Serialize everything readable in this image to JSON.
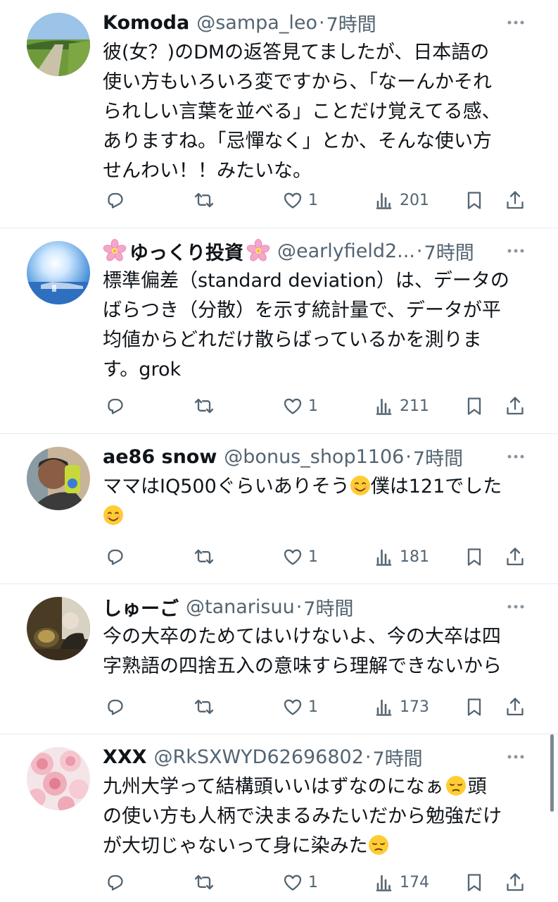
{
  "tweets": [
    {
      "name": "Komoda",
      "handle": "@sampa_leo",
      "separator": "·",
      "time": "7時間",
      "lines": [
        "彼(女？)のDMの返答見てましたが、日本語の",
        "使い方もいろいろ変ですから、「なーんかそれ",
        "られしい言葉を並べる」ことだけ覚えてる感、",
        "ありますね。「忌憚なく」とか、そんな使い方",
        "せんわい！！みたいな。"
      ],
      "likes": "1",
      "views": "201"
    },
    {
      "name": "ゆっくり投資",
      "handle": "@earlyfield2...",
      "separator": "·",
      "time": "7時間",
      "lines": [
        "標準偏差（standard deviation）は、データの",
        "ばらつき（分散）を示す統計量で、データが平",
        "均値からどれだけ散らばっているかを測りま",
        "す。grok"
      ],
      "likes": "1",
      "views": "211"
    },
    {
      "name": "ae86 snow",
      "handle": "@bonus_shop1106",
      "separator": "·",
      "time": "7時間",
      "line1_a": "ママはIQ500ぐらいありそう",
      "line1_b": "僕は121でした",
      "likes": "1",
      "views": "181"
    },
    {
      "name": "しゅーご",
      "handle": "@tanarisuu",
      "separator": "·",
      "time": "7時間",
      "lines": [
        "今の大卒のためてはいけないよ、今の大卒は四",
        "字熟語の四捨五入の意味すら理解できないから"
      ],
      "likes": "1",
      "views": "173"
    },
    {
      "name": "XXX",
      "handle": "@RkSXWYD62696802",
      "separator": "·",
      "time": "7時間",
      "line1_a": "九州大学って結構頭いいはずなのになぁ",
      "line1_b": "頭",
      "line2": "の使い方も人柄で決まるみたいだから勉強だけ",
      "line3": "が大切じゃないって身に染みた",
      "likes": "1",
      "views": "174"
    }
  ],
  "emoji_names": [
    "smiling-face-emoji",
    "pensive-face-emoji"
  ],
  "icon_names": [
    "reply-icon",
    "retweet-icon",
    "like-icon",
    "views-icon",
    "bookmark-icon",
    "share-icon",
    "more-icon",
    "cherry-blossom-icon"
  ],
  "colors": {
    "text": "#0f1419",
    "secondary": "#536471",
    "divider": "#e6e9ec"
  }
}
